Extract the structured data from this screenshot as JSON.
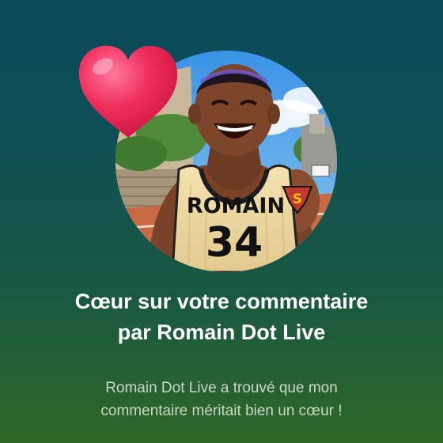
{
  "notification": {
    "title_lines": [
      "Cœur sur votre commentaire",
      "par Romain Dot Live"
    ],
    "subtitle_lines": [
      "Romain Dot Live a trouvé que mon",
      "commentaire méritait bien un cœur !"
    ]
  },
  "avatar": {
    "jersey_name": "ROMAIN",
    "jersey_number": "34",
    "shoulder_emblem": "S"
  },
  "icons": {
    "heart": "heart-icon"
  },
  "colors": {
    "heart": "#ef2f5e",
    "title": "#ffffff",
    "subtitle": "#c9d8c6",
    "background_top": "#0b4a5b",
    "background_bottom": "#2f6826"
  }
}
